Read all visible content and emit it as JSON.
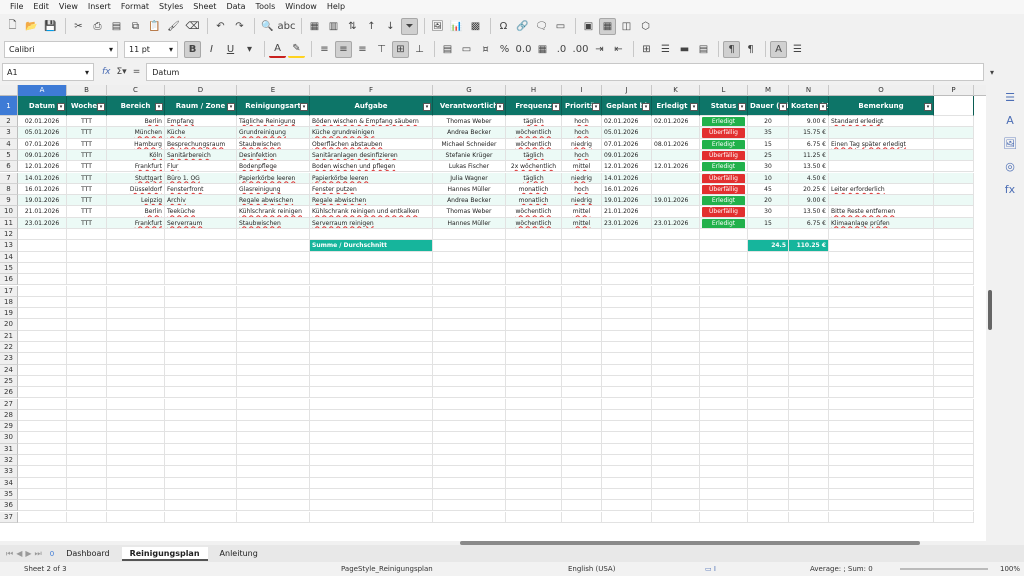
{
  "menu": [
    "File",
    "Edit",
    "View",
    "Insert",
    "Format",
    "Styles",
    "Sheet",
    "Data",
    "Tools",
    "Window",
    "Help"
  ],
  "toolbar": {
    "font": "Calibri",
    "size": "11 pt"
  },
  "formula": {
    "cell": "A1",
    "content": "Datum"
  },
  "colors": {
    "header_bg": "#0d7568",
    "status_ok": "#21b14b",
    "status_over": "#e22f2f",
    "sum_bg": "#16b59c"
  },
  "columns": [
    "A",
    "B",
    "C",
    "D",
    "E",
    "F",
    "G",
    "H",
    "I",
    "J",
    "K",
    "L",
    "M",
    "N",
    "O",
    "P"
  ],
  "headers": [
    "Datum",
    "Wochen",
    "Bereich",
    "Raum / Zone",
    "Reinigungsart",
    "Aufgabe",
    "Verantwortlich",
    "Frequenz",
    "Priorität",
    "Geplant bi",
    "Erledigt a",
    "Status",
    "Dauer (Min)",
    "Kosten (€)",
    "Bemerkung"
  ],
  "rows": [
    [
      "02.01.2026",
      "TTT",
      "Berlin",
      "Empfang",
      "Tägliche Reinigung",
      "Böden wischen & Empfang säubern",
      "Thomas Weber",
      "täglich",
      "hoch",
      "02.01.2026",
      "02.01.2026",
      "Erledigt",
      "20",
      "9.00 €",
      "Standard erledigt"
    ],
    [
      "05.01.2026",
      "TTT",
      "München",
      "Küche",
      "Grundreinigung",
      "Küche grundreinigen",
      "Andrea Becker",
      "wöchentlich",
      "hoch",
      "05.01.2026",
      "",
      "Überfällig",
      "35",
      "15.75 €",
      ""
    ],
    [
      "07.01.2026",
      "TTT",
      "Hamburg",
      "Besprechungsraum",
      "Staubwischen",
      "Oberflächen abstauben",
      "Michael Schneider",
      "wöchentlich",
      "niedrig",
      "07.01.2026",
      "08.01.2026",
      "Erledigt",
      "15",
      "6.75 €",
      "Einen Tag später erledigt"
    ],
    [
      "09.01.2026",
      "TTT",
      "Köln",
      "Sanitärbereich",
      "Desinfektion",
      "Sanitäranlagen desinfizieren",
      "Stefanie Krüger",
      "täglich",
      "hoch",
      "09.01.2026",
      "",
      "Überfällig",
      "25",
      "11.25 €",
      ""
    ],
    [
      "12.01.2026",
      "TTT",
      "Frankfurt",
      "Flur",
      "Bodenpflege",
      "Boden wischen und pflegen",
      "Lukas Fischer",
      "2x wöchentlich",
      "mittel",
      "12.01.2026",
      "12.01.2026",
      "Erledigt",
      "30",
      "13.50 €",
      ""
    ],
    [
      "14.01.2026",
      "TTT",
      "Stuttgart",
      "Büro 1. OG",
      "Papierkörbe leeren",
      "Papierkörbe leeren",
      "Julia Wagner",
      "täglich",
      "niedrig",
      "14.01.2026",
      "",
      "Überfällig",
      "10",
      "4.50 €",
      ""
    ],
    [
      "16.01.2026",
      "TTT",
      "Düsseldorf",
      "Fensterfront",
      "Glasreinigung",
      "Fenster putzen",
      "Hannes Müller",
      "monatlich",
      "hoch",
      "16.01.2026",
      "",
      "Überfällig",
      "45",
      "20.25 €",
      "Leiter erforderlich"
    ],
    [
      "19.01.2026",
      "TTT",
      "Leipzig",
      "Archiv",
      "Regale abwischen",
      "Regale abwischen",
      "Andrea Becker",
      "monatlich",
      "niedrig",
      "19.01.2026",
      "19.01.2026",
      "Erledigt",
      "20",
      "9.00 €",
      ""
    ],
    [
      "21.01.2026",
      "TTT",
      "Berlin",
      "Teeküche",
      "Kühlschrank reinigen",
      "Kühlschrank reinigen und entkalken",
      "Thomas Weber",
      "wöchentlich",
      "mittel",
      "21.01.2026",
      "",
      "Überfällig",
      "30",
      "13.50 €",
      "Bitte Reste entfernen"
    ],
    [
      "23.01.2026",
      "TTT",
      "Frankfurt",
      "Serverraum",
      "Staubwischen",
      "Serverraum reinigen",
      "Hannes Müller",
      "wöchentlich",
      "mittel",
      "23.01.2026",
      "23.01.2026",
      "Erledigt",
      "15",
      "6.75 €",
      "Klimaanlage prüfen"
    ]
  ],
  "summary": {
    "label": "Summe / Durchschnitt",
    "avg_duration": "24.5",
    "total_cost": "110.25 €"
  },
  "row_numbers": [
    "1",
    "2",
    "3",
    "4",
    "5",
    "6",
    "7",
    "8",
    "9",
    "10",
    "11",
    "12",
    "13",
    "14",
    "15",
    "16",
    "17",
    "18",
    "19",
    "20",
    "21",
    "22",
    "23",
    "24",
    "25",
    "26",
    "27",
    "28",
    "29",
    "30",
    "31",
    "32",
    "33",
    "34",
    "35",
    "36",
    "37"
  ],
  "tabs": {
    "counter": "0",
    "items": [
      "Dashboard",
      "Reinigungsplan",
      "Anleitung"
    ],
    "active": "Reinigungsplan"
  },
  "status": {
    "sheet": "Sheet 2 of 3",
    "page_style": "PageStyle_Reinigungsplan",
    "language": "English (USA)",
    "calc": "Average: ; Sum: 0",
    "zoom": "100%"
  }
}
